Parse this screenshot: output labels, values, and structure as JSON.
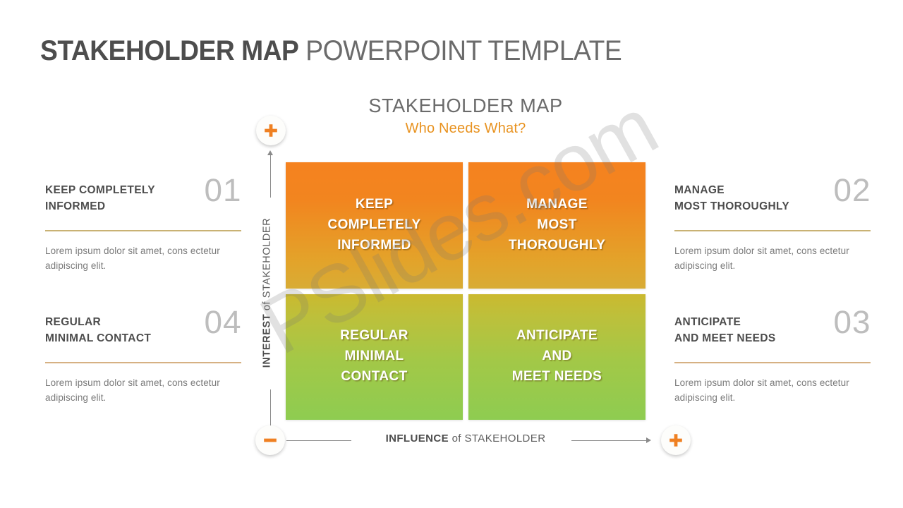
{
  "slide": {
    "title_bold": "STAKEHOLDER MAP",
    "title_light": " POWERPOINT TEMPLATE",
    "watermark": "PSlides.com"
  },
  "chart_heading": {
    "title": "STAKEHOLDER MAP",
    "subtitle": "Who Needs What?"
  },
  "axes": {
    "y_strong": "INTEREST",
    "y_light": " of STAKEHOLDER",
    "x_strong": "INFLUENCE",
    "x_light": " of STAKEHOLDER",
    "marker_plus_top": "plus",
    "marker_minus_left": "minus",
    "marker_plus_right": "plus"
  },
  "matrix": {
    "quadrants": [
      {
        "id": "top-left",
        "label": "KEEP\nCOMPLETELY\nINFORMED",
        "color": "#f2851f"
      },
      {
        "id": "top-right",
        "label": "MANAGE\nMOST\nTHOROUGHLY",
        "color": "#f2851f"
      },
      {
        "id": "bottom-left",
        "label": "REGULAR\nMINIMAL\nCONTACT",
        "color": "#a3c847"
      },
      {
        "id": "bottom-right",
        "label": "ANTICIPATE\nAND\nMEET NEEDS",
        "color": "#a3c847"
      }
    ]
  },
  "panels": [
    {
      "num": "01",
      "title": "KEEP COMPLETELY\nINFORMED",
      "body": "Lorem ipsum dolor sit amet, cons ectetur adipiscing elit.",
      "rule_color": "#c9b274"
    },
    {
      "num": "02",
      "title": "MANAGE\nMOST THOROUGHLY",
      "body": "Lorem ipsum dolor sit amet, cons ectetur adipiscing elit.",
      "rule_color": "#c9b274"
    },
    {
      "num": "03",
      "title": "ANTICIPATE\nAND MEET NEEDS",
      "body": "Lorem ipsum dolor sit amet, cons ectetur adipiscing elit.",
      "rule_color": "#d6b183"
    },
    {
      "num": "04",
      "title": "REGULAR\nMINIMAL CONTACT",
      "body": "Lorem ipsum dolor sit amet, cons ectetur adipiscing elit.",
      "rule_color": "#d6b183"
    }
  ],
  "colors": {
    "orange": "#f2851f",
    "orange_accent": "#e8921f",
    "green": "#a3c847",
    "dark_gray": "#4d4d4d",
    "num_gray": "#bdbdbd",
    "body_gray": "#7a7a7a"
  }
}
